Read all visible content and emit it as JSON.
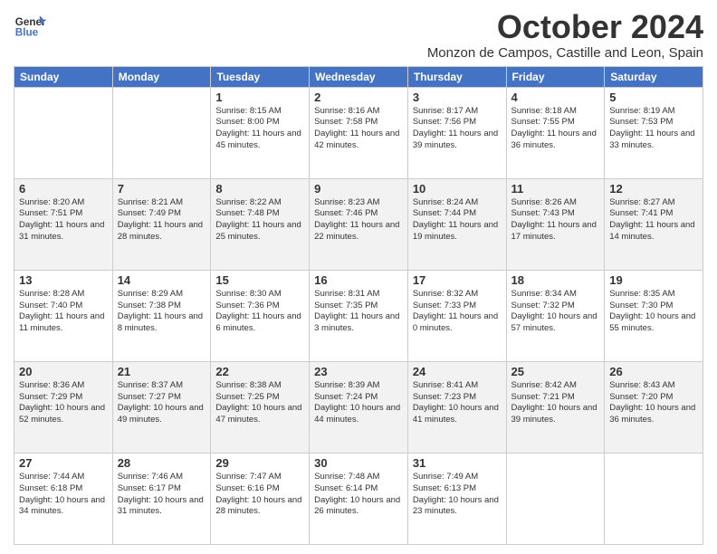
{
  "header": {
    "logo_line1": "General",
    "logo_line2": "Blue",
    "month": "October 2024",
    "location": "Monzon de Campos, Castille and Leon, Spain"
  },
  "days_of_week": [
    "Sunday",
    "Monday",
    "Tuesday",
    "Wednesday",
    "Thursday",
    "Friday",
    "Saturday"
  ],
  "weeks": [
    [
      {
        "day": "",
        "info": ""
      },
      {
        "day": "",
        "info": ""
      },
      {
        "day": "1",
        "info": "Sunrise: 8:15 AM\nSunset: 8:00 PM\nDaylight: 11 hours and 45 minutes."
      },
      {
        "day": "2",
        "info": "Sunrise: 8:16 AM\nSunset: 7:58 PM\nDaylight: 11 hours and 42 minutes."
      },
      {
        "day": "3",
        "info": "Sunrise: 8:17 AM\nSunset: 7:56 PM\nDaylight: 11 hours and 39 minutes."
      },
      {
        "day": "4",
        "info": "Sunrise: 8:18 AM\nSunset: 7:55 PM\nDaylight: 11 hours and 36 minutes."
      },
      {
        "day": "5",
        "info": "Sunrise: 8:19 AM\nSunset: 7:53 PM\nDaylight: 11 hours and 33 minutes."
      }
    ],
    [
      {
        "day": "6",
        "info": "Sunrise: 8:20 AM\nSunset: 7:51 PM\nDaylight: 11 hours and 31 minutes."
      },
      {
        "day": "7",
        "info": "Sunrise: 8:21 AM\nSunset: 7:49 PM\nDaylight: 11 hours and 28 minutes."
      },
      {
        "day": "8",
        "info": "Sunrise: 8:22 AM\nSunset: 7:48 PM\nDaylight: 11 hours and 25 minutes."
      },
      {
        "day": "9",
        "info": "Sunrise: 8:23 AM\nSunset: 7:46 PM\nDaylight: 11 hours and 22 minutes."
      },
      {
        "day": "10",
        "info": "Sunrise: 8:24 AM\nSunset: 7:44 PM\nDaylight: 11 hours and 19 minutes."
      },
      {
        "day": "11",
        "info": "Sunrise: 8:26 AM\nSunset: 7:43 PM\nDaylight: 11 hours and 17 minutes."
      },
      {
        "day": "12",
        "info": "Sunrise: 8:27 AM\nSunset: 7:41 PM\nDaylight: 11 hours and 14 minutes."
      }
    ],
    [
      {
        "day": "13",
        "info": "Sunrise: 8:28 AM\nSunset: 7:40 PM\nDaylight: 11 hours and 11 minutes."
      },
      {
        "day": "14",
        "info": "Sunrise: 8:29 AM\nSunset: 7:38 PM\nDaylight: 11 hours and 8 minutes."
      },
      {
        "day": "15",
        "info": "Sunrise: 8:30 AM\nSunset: 7:36 PM\nDaylight: 11 hours and 6 minutes."
      },
      {
        "day": "16",
        "info": "Sunrise: 8:31 AM\nSunset: 7:35 PM\nDaylight: 11 hours and 3 minutes."
      },
      {
        "day": "17",
        "info": "Sunrise: 8:32 AM\nSunset: 7:33 PM\nDaylight: 11 hours and 0 minutes."
      },
      {
        "day": "18",
        "info": "Sunrise: 8:34 AM\nSunset: 7:32 PM\nDaylight: 10 hours and 57 minutes."
      },
      {
        "day": "19",
        "info": "Sunrise: 8:35 AM\nSunset: 7:30 PM\nDaylight: 10 hours and 55 minutes."
      }
    ],
    [
      {
        "day": "20",
        "info": "Sunrise: 8:36 AM\nSunset: 7:29 PM\nDaylight: 10 hours and 52 minutes."
      },
      {
        "day": "21",
        "info": "Sunrise: 8:37 AM\nSunset: 7:27 PM\nDaylight: 10 hours and 49 minutes."
      },
      {
        "day": "22",
        "info": "Sunrise: 8:38 AM\nSunset: 7:25 PM\nDaylight: 10 hours and 47 minutes."
      },
      {
        "day": "23",
        "info": "Sunrise: 8:39 AM\nSunset: 7:24 PM\nDaylight: 10 hours and 44 minutes."
      },
      {
        "day": "24",
        "info": "Sunrise: 8:41 AM\nSunset: 7:23 PM\nDaylight: 10 hours and 41 minutes."
      },
      {
        "day": "25",
        "info": "Sunrise: 8:42 AM\nSunset: 7:21 PM\nDaylight: 10 hours and 39 minutes."
      },
      {
        "day": "26",
        "info": "Sunrise: 8:43 AM\nSunset: 7:20 PM\nDaylight: 10 hours and 36 minutes."
      }
    ],
    [
      {
        "day": "27",
        "info": "Sunrise: 7:44 AM\nSunset: 6:18 PM\nDaylight: 10 hours and 34 minutes."
      },
      {
        "day": "28",
        "info": "Sunrise: 7:46 AM\nSunset: 6:17 PM\nDaylight: 10 hours and 31 minutes."
      },
      {
        "day": "29",
        "info": "Sunrise: 7:47 AM\nSunset: 6:16 PM\nDaylight: 10 hours and 28 minutes."
      },
      {
        "day": "30",
        "info": "Sunrise: 7:48 AM\nSunset: 6:14 PM\nDaylight: 10 hours and 26 minutes."
      },
      {
        "day": "31",
        "info": "Sunrise: 7:49 AM\nSunset: 6:13 PM\nDaylight: 10 hours and 23 minutes."
      },
      {
        "day": "",
        "info": ""
      },
      {
        "day": "",
        "info": ""
      }
    ]
  ]
}
